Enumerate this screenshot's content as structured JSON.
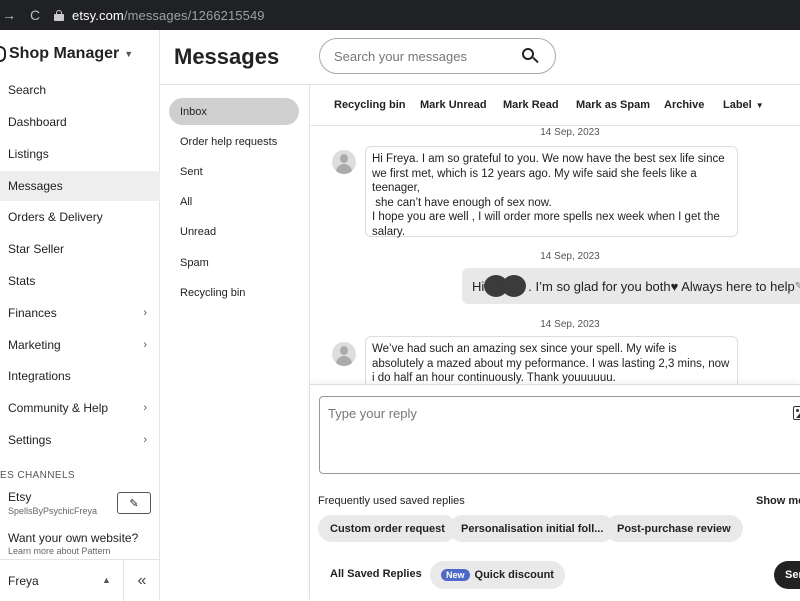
{
  "browser": {
    "back_icon": "→",
    "reload_icon": "C",
    "url_host": "etsy.com",
    "url_path": "/messages/1266215549"
  },
  "sidebar": {
    "shop_title": "Shop Manager",
    "items": [
      {
        "label": "Search"
      },
      {
        "label": "Dashboard"
      },
      {
        "label": "Listings"
      },
      {
        "label": "Messages",
        "active": true
      },
      {
        "label": "Orders & Delivery"
      },
      {
        "label": "Star Seller"
      },
      {
        "label": "Stats"
      },
      {
        "label": "Finances",
        "has_submenu": true
      },
      {
        "label": "Marketing",
        "has_submenu": true
      },
      {
        "label": "Integrations"
      },
      {
        "label": "Community & Help",
        "has_submenu": true
      },
      {
        "label": "Settings",
        "has_submenu": true
      }
    ],
    "channels_label": "ES CHANNELS",
    "etsy_name": "Etsy",
    "etsy_shop": "SpellsByPsychicFreya",
    "own_site": "Want your own website?",
    "learn_more": "Learn more about Pattern",
    "user_name": "Freya",
    "collapse_icon": "«"
  },
  "header": {
    "title": "Messages",
    "search_placeholder": "Search your messages"
  },
  "folders": [
    {
      "label": "Inbox",
      "active": true
    },
    {
      "label": "Order help requests"
    },
    {
      "label": "Sent"
    },
    {
      "label": "All"
    },
    {
      "label": "Unread"
    },
    {
      "label": "Spam"
    },
    {
      "label": "Recycling bin"
    }
  ],
  "toolbar": {
    "recycling_bin": "Recycling bin",
    "mark_unread": "Mark Unread",
    "mark_read": "Mark Read",
    "mark_spam": "Mark as Spam",
    "archive": "Archive",
    "label": "Label"
  },
  "thread": {
    "date1": "14 Sep, 2023",
    "message1": "Hi Freya. I am so grateful to you. We now have the best sex life since we first met, which is 12 years ago. My wife said she feels like a teenager,\n she can’t have enough of sex now.\nI hope you are well , I will order more spells nex week when I get the salary.",
    "date2": "14 Sep, 2023",
    "reply_greeting": "Hi",
    "reply_text": ". I’m so glad for you both♥ Always here to help",
    "date3": "14 Sep, 2023",
    "message2": "We’ve had such an amazing sex since your spell. My wife is  absolutely a mazed about my peformance. I was lasting 2,3 mins, now i do half an hour continuously. Thank youuuuuu."
  },
  "reply": {
    "placeholder": "Type your reply",
    "saved_label": "Frequently used saved replies",
    "show_more": "Show mo",
    "chips": [
      "Custom order request",
      "Personalisation initial foll...",
      "Post-purchase review"
    ],
    "all_saved": "All Saved Replies",
    "new_badge": "New",
    "quick_discount": "Quick discount",
    "send": "Sen"
  }
}
